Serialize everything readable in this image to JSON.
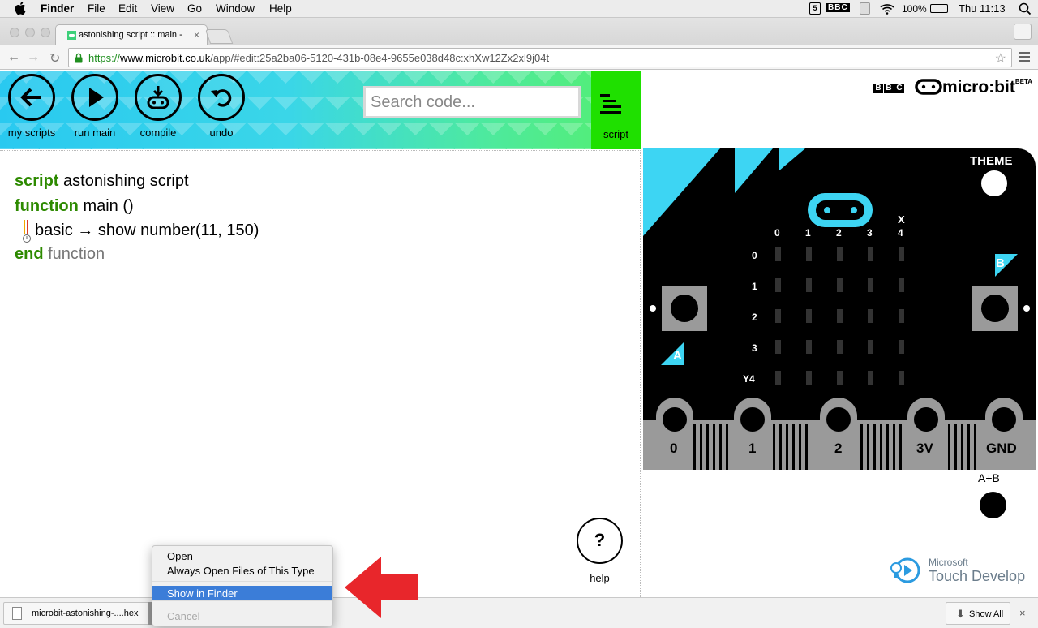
{
  "menubar": {
    "app": "Finder",
    "items": [
      "File",
      "Edit",
      "View",
      "Go",
      "Window",
      "Help"
    ],
    "status": {
      "bbc": "BBC",
      "battery": "100%",
      "clock": "Thu 11:13"
    }
  },
  "browser": {
    "tab_title": "astonishing script :: main -",
    "url": {
      "scheme": "https://",
      "host": "www.microbit.co.uk",
      "path": "/app/#edit:25a2ba06-5120-431b-08e4-9655e038d48c:xhXw12Zx2xl9j04t"
    }
  },
  "editor": {
    "buttons": [
      {
        "label": "my scripts",
        "icon": "arrow-left-icon"
      },
      {
        "label": "run main",
        "icon": "play-icon"
      },
      {
        "label": "compile",
        "icon": "compile-icon"
      },
      {
        "label": "undo",
        "icon": "undo-icon"
      }
    ],
    "search_placeholder": "Search code...",
    "script_label": "script",
    "code": {
      "line1_kw": "script",
      "line1_rest": "astonishing script",
      "line2_kw": "function",
      "line2_rest": "main ()",
      "line3_ns": "basic",
      "line3_arrow": "→",
      "line3_call": "show number(11, 150)",
      "line4_kw": "end",
      "line4_rest": "function"
    },
    "help_symbol": "?",
    "help_label": "help"
  },
  "simulator": {
    "bbc_letters": [
      "B",
      "B",
      "C"
    ],
    "logo_text": "micro:bit",
    "logo_beta": "BETA",
    "theme_label": "THEME",
    "col_labels": [
      "0",
      "1",
      "2",
      "3",
      "4"
    ],
    "row_labels": [
      "0",
      "1",
      "2",
      "3",
      "Y4"
    ],
    "x_label": "X",
    "button_a": "A",
    "button_b": "B",
    "pins": [
      "0",
      "1",
      "2",
      "3V",
      "GND"
    ],
    "ab_label": "A+B",
    "ms_line1": "Microsoft",
    "ms_line2": "Touch Develop",
    "colors": {
      "accent": "#3dd5f3",
      "board": "#000000",
      "pads": "#9a9a9a"
    }
  },
  "downloads": {
    "file": "microbit-astonishing-....hex",
    "show_all": "Show All",
    "close": "×"
  },
  "context_menu": {
    "items": [
      "Open",
      "Always Open Files of This Type",
      "Show in Finder",
      "Cancel"
    ],
    "selected": "Show in Finder",
    "disabled": "Cancel"
  }
}
